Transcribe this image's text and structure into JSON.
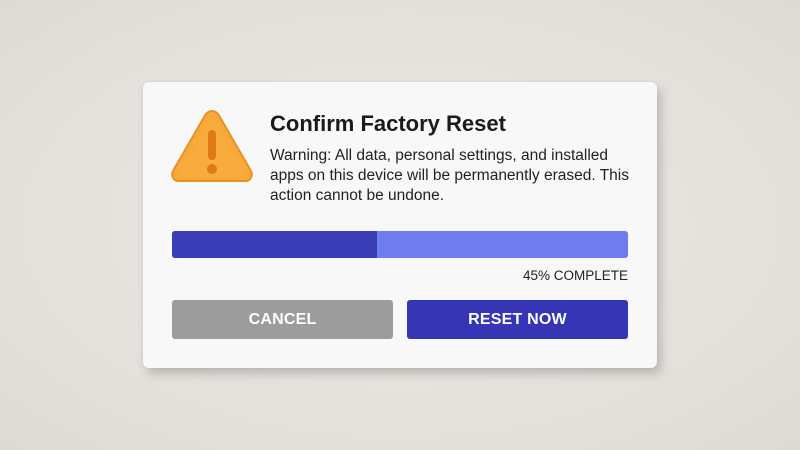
{
  "dialog": {
    "title": "Confirm Factory Reset",
    "message": "Warning: All data, personal settings, and installed apps on this device will be permanently erased. This action cannot be undone.",
    "icon": "warning-triangle-icon"
  },
  "progress": {
    "value_percent": 45,
    "label": "45% COMPLETE"
  },
  "buttons": {
    "cancel_label": "CANCEL",
    "reset_label": "RESET NOW"
  },
  "colors": {
    "background": "#e6e2dd",
    "dialog": "#f8f8f8",
    "warning_orange": "#f7a93a",
    "progress_fill": "#3a3db6",
    "progress_track": "#6f7ced",
    "cancel_button": "#9c9c9c",
    "reset_button": "#3535b5"
  }
}
